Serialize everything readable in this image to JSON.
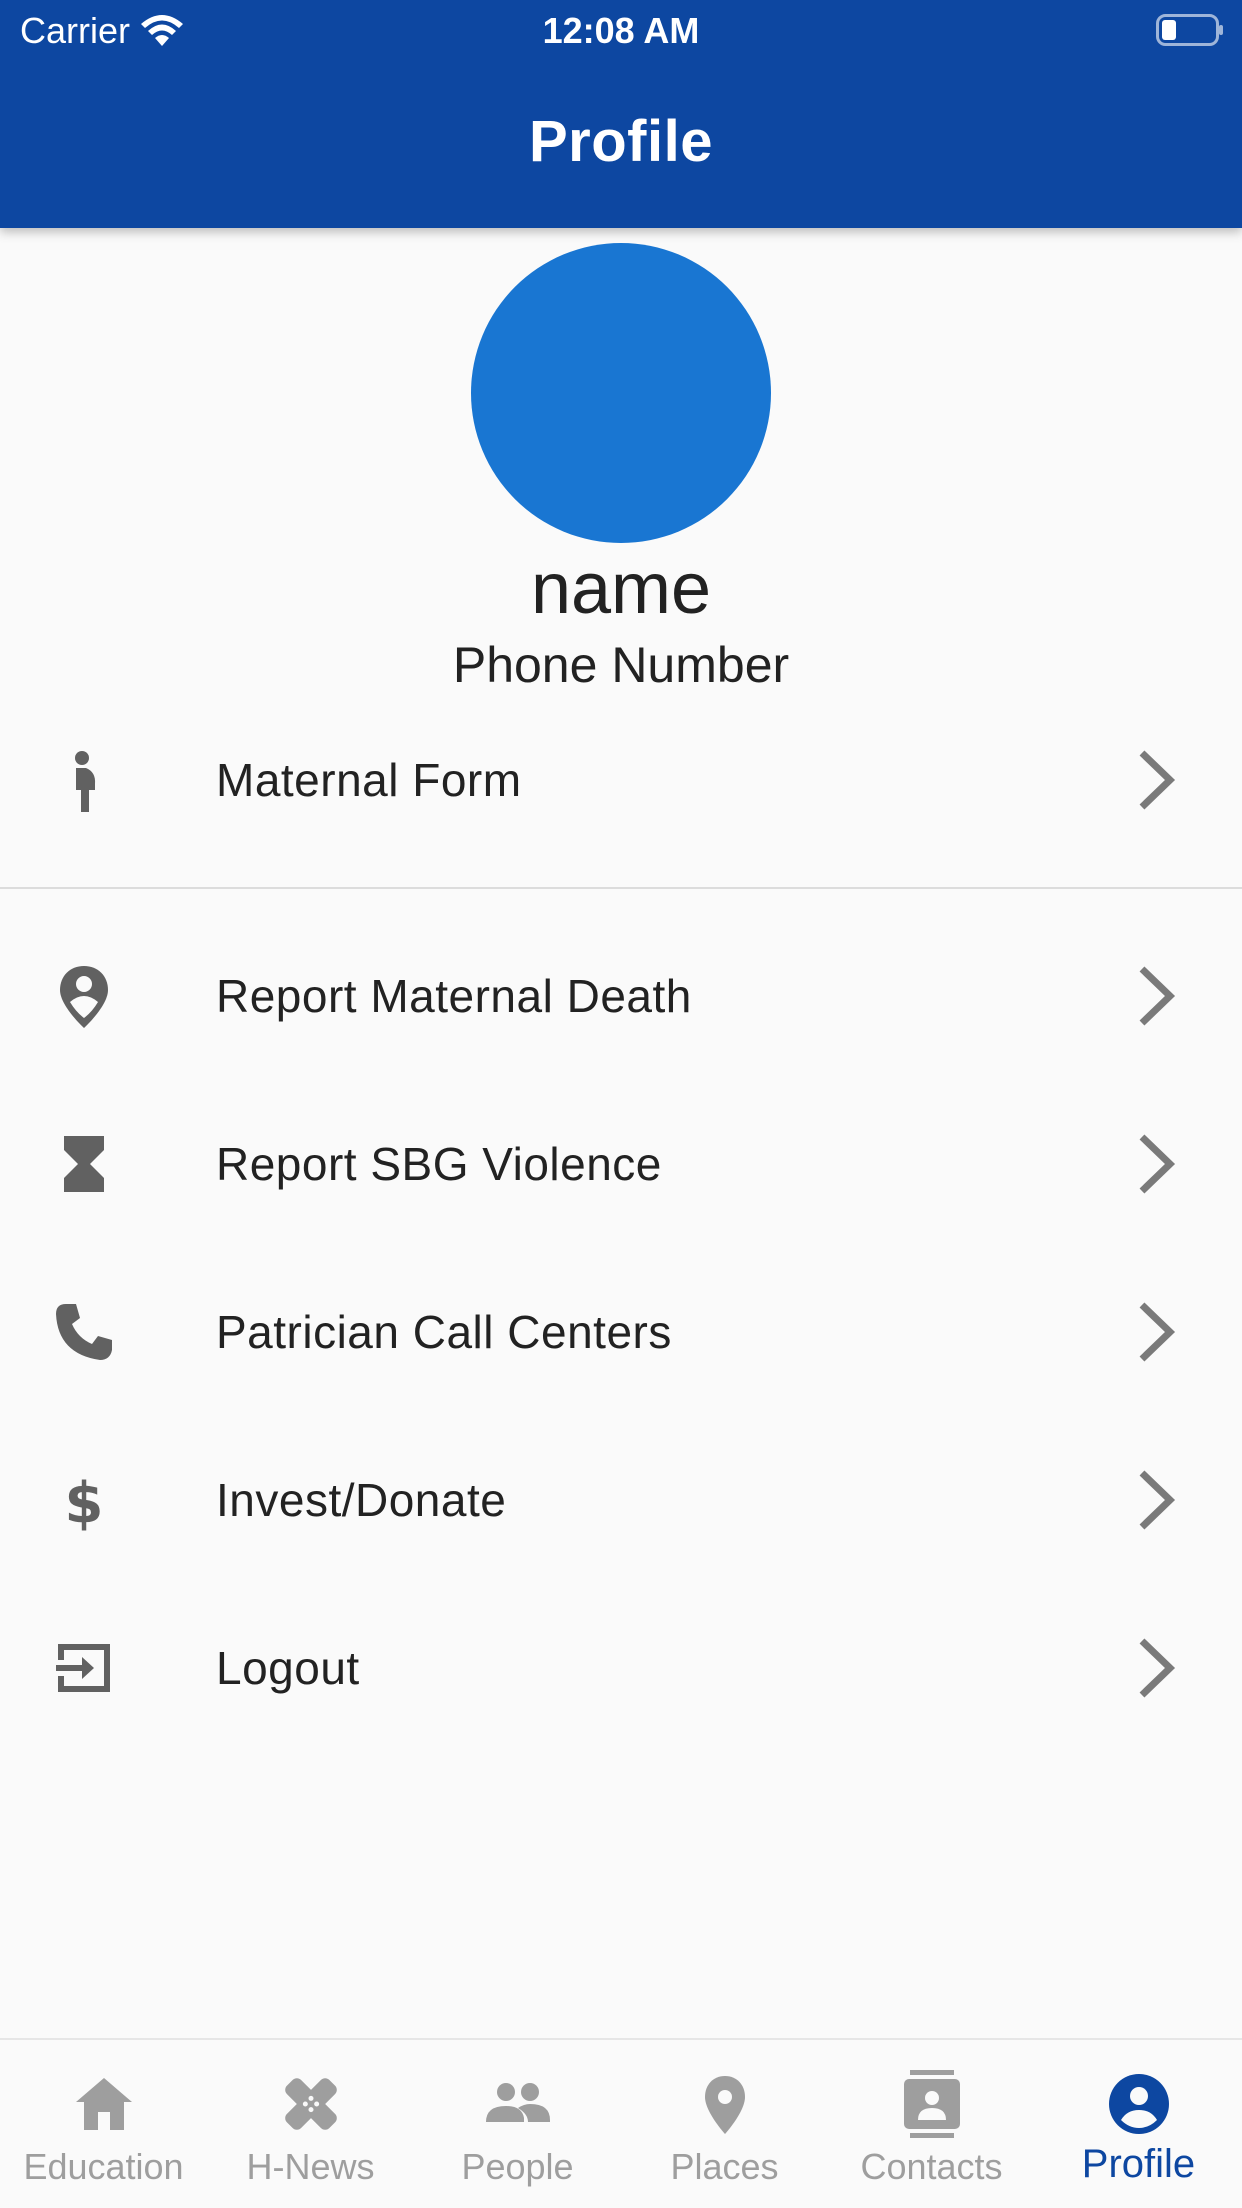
{
  "status_bar": {
    "carrier": "Carrier",
    "time": "12:08 AM"
  },
  "appbar": {
    "title": "Profile"
  },
  "profile": {
    "name": "name",
    "phone": "Phone Number",
    "avatar_color": "#1976d2"
  },
  "menu": {
    "items": [
      {
        "label": "Maternal Form",
        "icon": "pregnant-woman-icon"
      },
      {
        "label": "Report Maternal Death",
        "icon": "location-person-icon"
      },
      {
        "label": "Report SBG Violence",
        "icon": "hourglass-icon"
      },
      {
        "label": "Patrician Call Centers",
        "icon": "phone-icon"
      },
      {
        "label": "Invest/Donate",
        "icon": "dollar-icon"
      },
      {
        "label": "Logout",
        "icon": "exit-icon"
      }
    ]
  },
  "bottom_nav": {
    "items": [
      {
        "label": "Education",
        "icon": "home-icon"
      },
      {
        "label": "H-News",
        "icon": "bandage-icon"
      },
      {
        "label": "People",
        "icon": "people-icon"
      },
      {
        "label": "Places",
        "icon": "place-icon"
      },
      {
        "label": "Contacts",
        "icon": "contacts-icon"
      },
      {
        "label": "Profile",
        "icon": "account-circle-icon"
      }
    ],
    "active": "Profile"
  },
  "colors": {
    "primary": "#0d47a1",
    "accent": "#1976d2",
    "icon_grey": "#616161",
    "nav_inactive": "#9e9e9e",
    "background": "#fafafa"
  }
}
